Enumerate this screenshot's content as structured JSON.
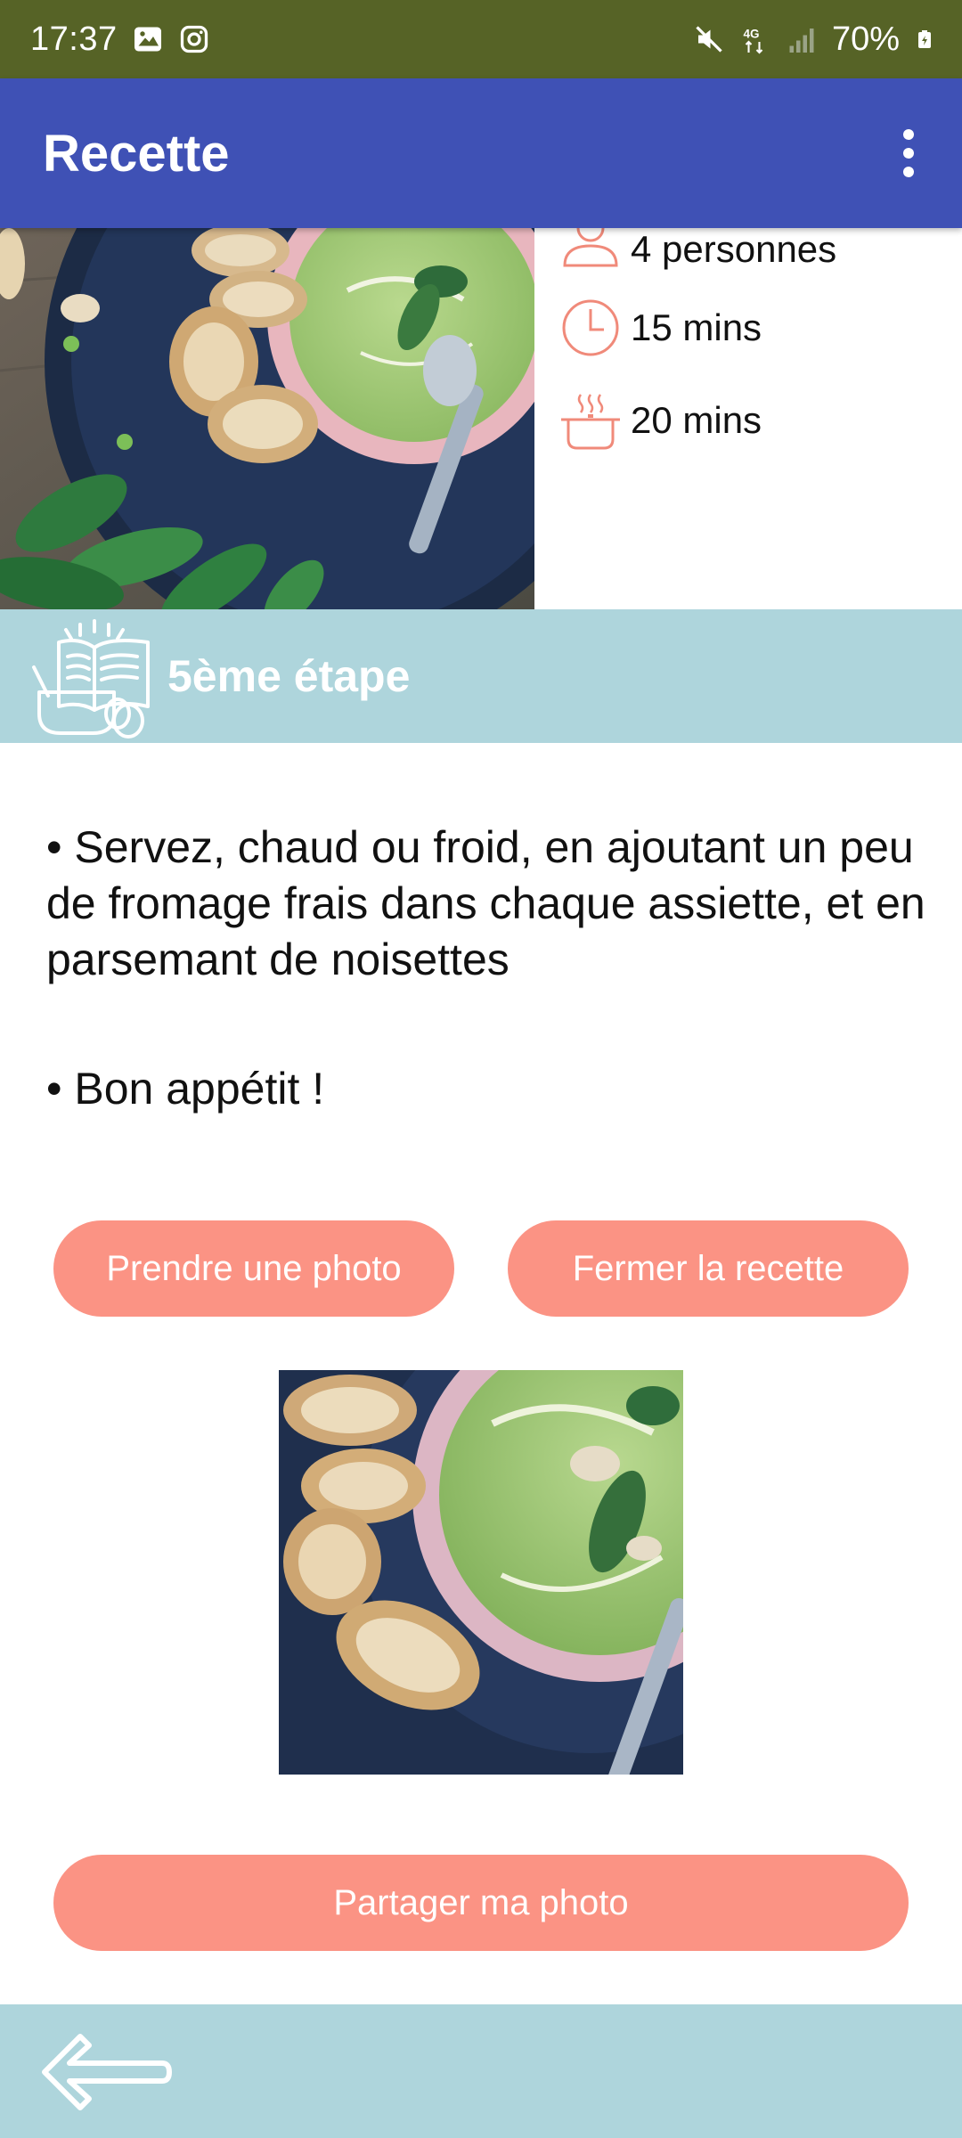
{
  "status_bar": {
    "time": "17:37",
    "battery": "70%",
    "network": "4G",
    "icons": [
      "gallery-icon",
      "instagram-icon",
      "mute-icon",
      "network-4g-icon",
      "signal-icon",
      "battery-icon"
    ]
  },
  "app_bar": {
    "title": "Recette",
    "overflow_icon": "more-vert-icon"
  },
  "recipe": {
    "servings": "4 personnes",
    "prep_time": "15 mins",
    "cook_time": "20 mins",
    "hero_image": "pea-soup-with-bread-photo"
  },
  "step": {
    "title": "5ème étape",
    "icon": "cookbook-icon",
    "instructions": [
      "• Servez, chaud ou froid, en ajoutant un peu de fromage frais dans chaque assiette, et en parsemant de noisettes",
      "• Bon appétit !"
    ]
  },
  "actions": {
    "take_photo": "Prendre une photo",
    "close_recipe": "Fermer la recette",
    "share_photo": "Partager ma photo"
  },
  "bottom_bar": {
    "back_icon": "arrow-left-icon"
  },
  "colors": {
    "status_bar": "#566326",
    "app_bar": "#3f51b5",
    "accent_button": "#fb9384",
    "banner": "#aed5dc",
    "icon_stroke": "#f08a7a"
  }
}
